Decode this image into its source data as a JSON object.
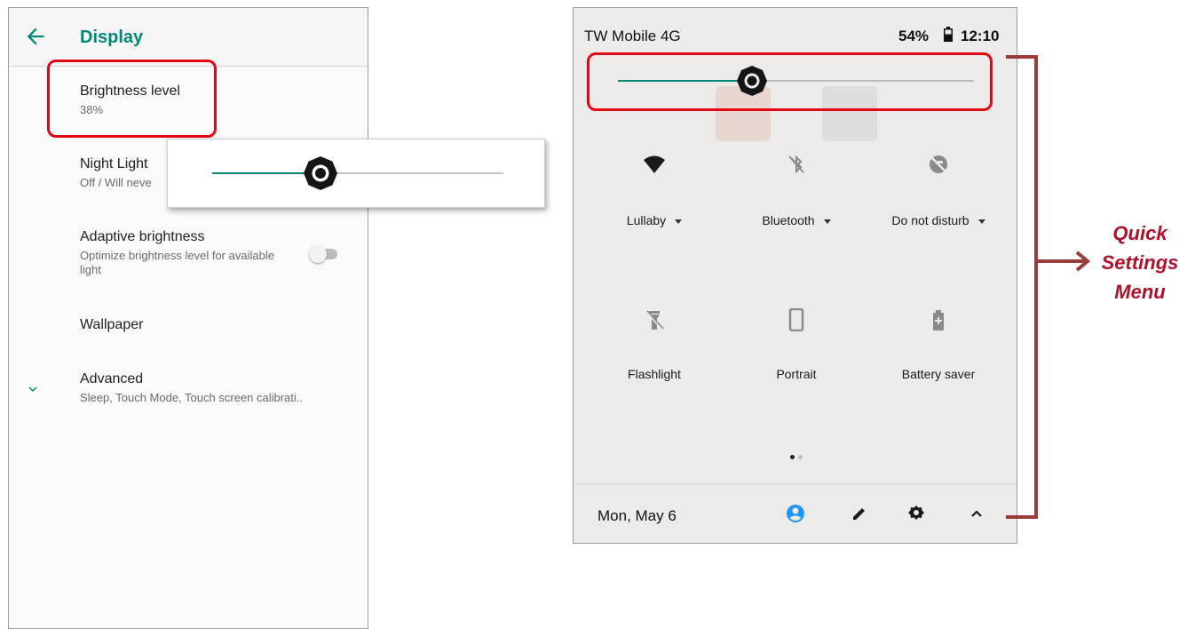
{
  "display_settings": {
    "title": "Display",
    "items": [
      {
        "title": "Brightness level",
        "subtitle": "38%"
      },
      {
        "title": "Night Light",
        "subtitle": "Off / Will neve"
      },
      {
        "title": "Adaptive brightness",
        "subtitle": "Optimize brightness level for available light",
        "toggle_on": false
      },
      {
        "title": "Wallpaper",
        "subtitle": ""
      },
      {
        "title": "Advanced",
        "subtitle": "Sleep, Touch Mode, Touch screen calibrati.."
      }
    ],
    "brightness_slider_percent": 38
  },
  "quick_settings": {
    "status_bar": {
      "carrier": "TW Mobile 4G",
      "battery": "54%",
      "time": "12:10"
    },
    "brightness_slider_percent": 38,
    "tiles": [
      {
        "label": "Lullaby",
        "icon": "wifi-icon",
        "has_dropdown": true
      },
      {
        "label": "Bluetooth",
        "icon": "bluetooth-off-icon",
        "has_dropdown": true
      },
      {
        "label": "Do not disturb",
        "icon": "do-not-disturb-off-icon",
        "has_dropdown": true
      },
      {
        "label": "Flashlight",
        "icon": "flashlight-off-icon",
        "has_dropdown": false
      },
      {
        "label": "Portrait",
        "icon": "portrait-icon",
        "has_dropdown": false
      },
      {
        "label": "Battery saver",
        "icon": "battery-saver-icon",
        "has_dropdown": false
      }
    ],
    "page_indicator": {
      "pages": 2,
      "current": 1
    },
    "footer": {
      "date": "Mon, May 6",
      "icons": [
        "user-icon",
        "edit-icon",
        "settings-icon",
        "collapse-icon"
      ]
    }
  },
  "annotation": {
    "label_line1": "Quick",
    "label_line2": "Settings",
    "label_line3": "Menu"
  },
  "colors": {
    "accent": "#00897b",
    "highlight": "#e30613",
    "annotation": "#b0102a",
    "bracket": "#9b3b3b"
  }
}
